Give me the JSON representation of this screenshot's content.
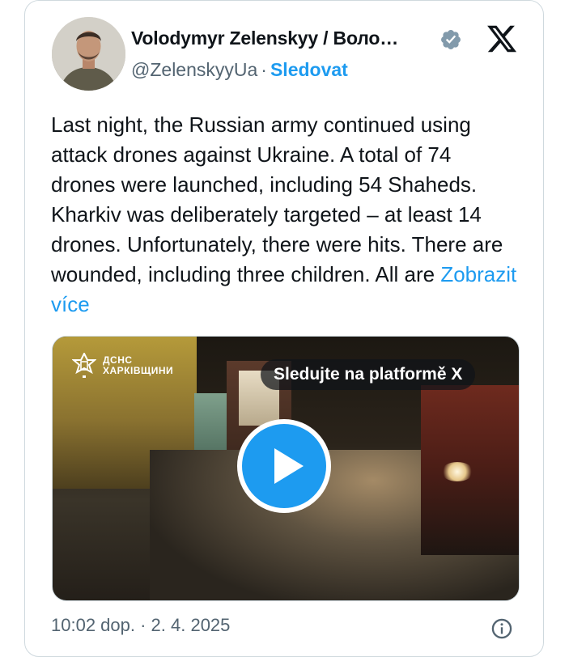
{
  "author": {
    "display_name": "Volodymyr Zelenskyy / Воло…",
    "handle": "@ZelenskyyUa",
    "separator": "·",
    "follow_label": "Sledovat",
    "verified_icon": "verified-badge-icon"
  },
  "platform_icon": "x-logo-icon",
  "post": {
    "text": "Last night, the Russian army continued using attack drones against Ukraine. A total of 74 drones were launched, including 54 Shaheds. Kharkiv was deliberately targeted – at least 14 drones. Unfortunately, there were hits. There are wounded, including three children. All are ",
    "show_more_label": "Zobrazit více"
  },
  "media": {
    "watermark_line1": "ДСНС",
    "watermark_line2": "ХАРКІВЩИНИ",
    "watch_on_x_label": "Sledujte na platformě X",
    "play_icon": "play-icon"
  },
  "footer": {
    "timestamp": "10:02 dop. · 2. 4. 2025",
    "info_icon": "info-icon"
  },
  "colors": {
    "accent": "#1d9bf0",
    "secondary_text": "#536471",
    "border": "#cfd9de"
  }
}
